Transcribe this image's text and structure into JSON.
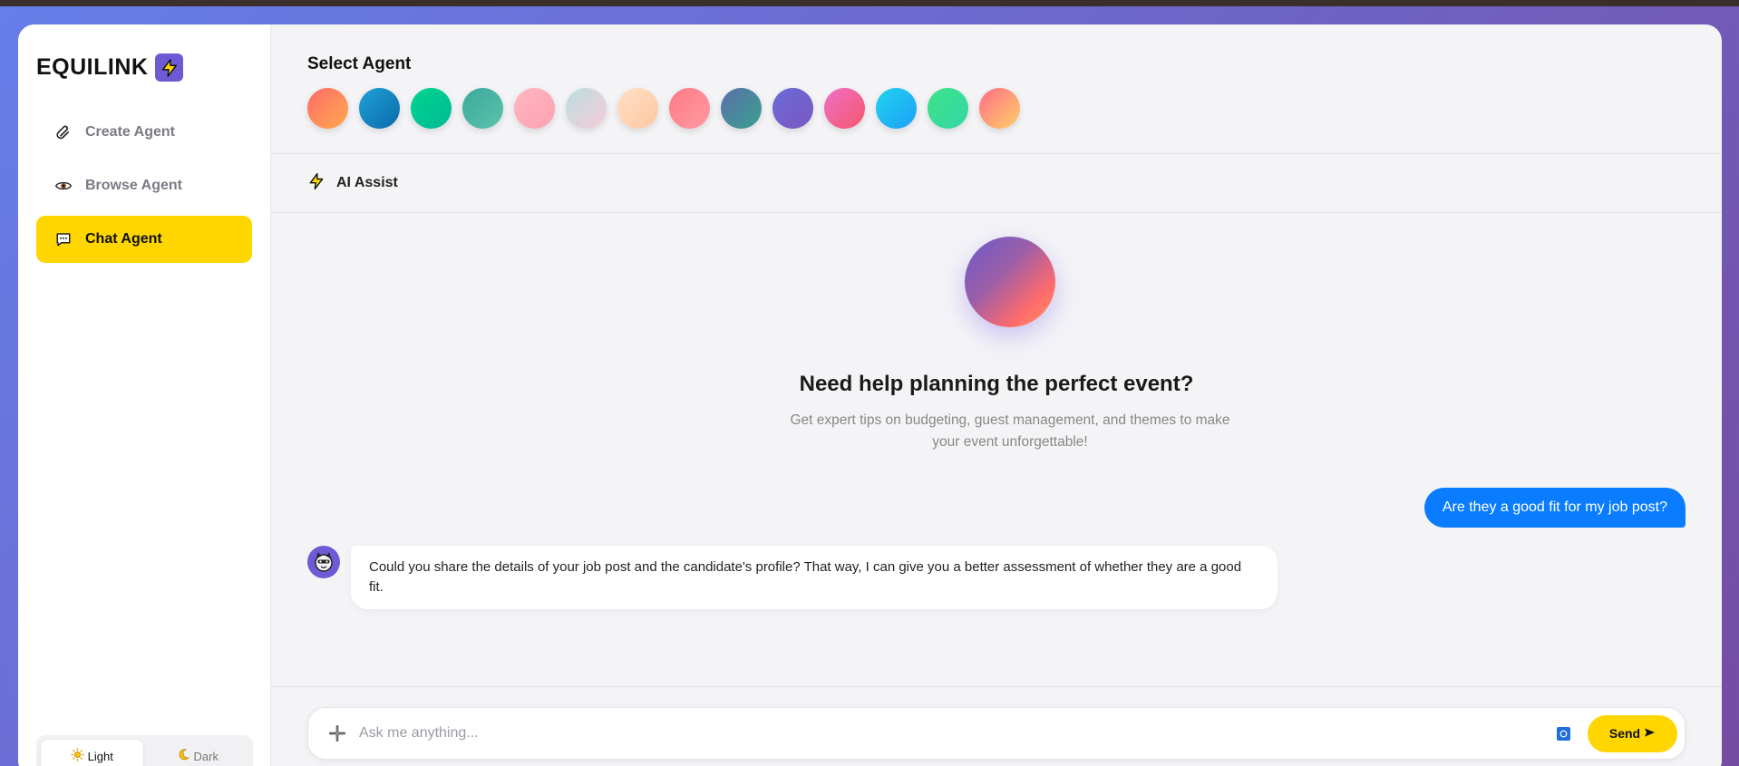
{
  "brand": {
    "name": "EQUILINK",
    "badge_icon": "lightning-icon",
    "badge_color": "#6c5bd4"
  },
  "sidebar": {
    "items": [
      {
        "label": "Create Agent",
        "icon": "paperclip-icon",
        "active": false
      },
      {
        "label": "Browse Agent",
        "icon": "eye-icon",
        "active": false
      },
      {
        "label": "Chat Agent",
        "icon": "chat-bubble-icon",
        "active": true
      }
    ],
    "active_color": "#ffd600",
    "theme": {
      "light_label": "Light",
      "dark_label": "Dark",
      "selected": "Light"
    }
  },
  "agent_picker": {
    "title": "Select Agent",
    "agents": [
      {
        "gradient": [
          "#ff6b6b",
          "#ffa94d"
        ]
      },
      {
        "gradient": [
          "#1fa2d8",
          "#0b69a8"
        ]
      },
      {
        "gradient": [
          "#00d68f",
          "#00b894"
        ]
      },
      {
        "gradient": [
          "#3ba99c",
          "#5cc2ac"
        ]
      },
      {
        "gradient": [
          "#ffb6c1",
          "#ffa1b0"
        ]
      },
      {
        "gradient": [
          "#b8e0e0",
          "#f7cad8"
        ]
      },
      {
        "gradient": [
          "#ffe0c7",
          "#ffc7a0"
        ]
      },
      {
        "gradient": [
          "#ff7a85",
          "#ff9aa2"
        ]
      },
      {
        "gradient": [
          "#5b6ea8",
          "#3aa091"
        ]
      },
      {
        "gradient": [
          "#6a6ad8",
          "#7a58c0"
        ]
      },
      {
        "gradient": [
          "#f06fc6",
          "#f5576c"
        ]
      },
      {
        "gradient": [
          "#22d3f0",
          "#1ba0f7"
        ]
      },
      {
        "gradient": [
          "#3be387",
          "#37d6a6"
        ]
      },
      {
        "gradient": [
          "#ff6b8a",
          "#ffd166"
        ]
      }
    ]
  },
  "assist": {
    "label": "AI Assist",
    "icon": "lightning-icon"
  },
  "hero": {
    "title": "Need help planning the perfect event?",
    "subtitle": "Get expert tips on budgeting, guest management, and themes to make your event unforgettable!"
  },
  "messages": [
    {
      "role": "user",
      "text": "Are they a good fit for my job post?"
    },
    {
      "role": "bot",
      "text": "Could you share the details of your job post and the candidate's profile? That way, I can give you a better assessment of whether they are a good fit."
    }
  ],
  "composer": {
    "placeholder": "Ask me anything...",
    "value": "",
    "send_label": "Send",
    "send_icon": "arrow-right-icon",
    "attach_icon": "plus-icon",
    "send_color": "#ffd600",
    "user_bubble_color": "#0a7cff"
  }
}
